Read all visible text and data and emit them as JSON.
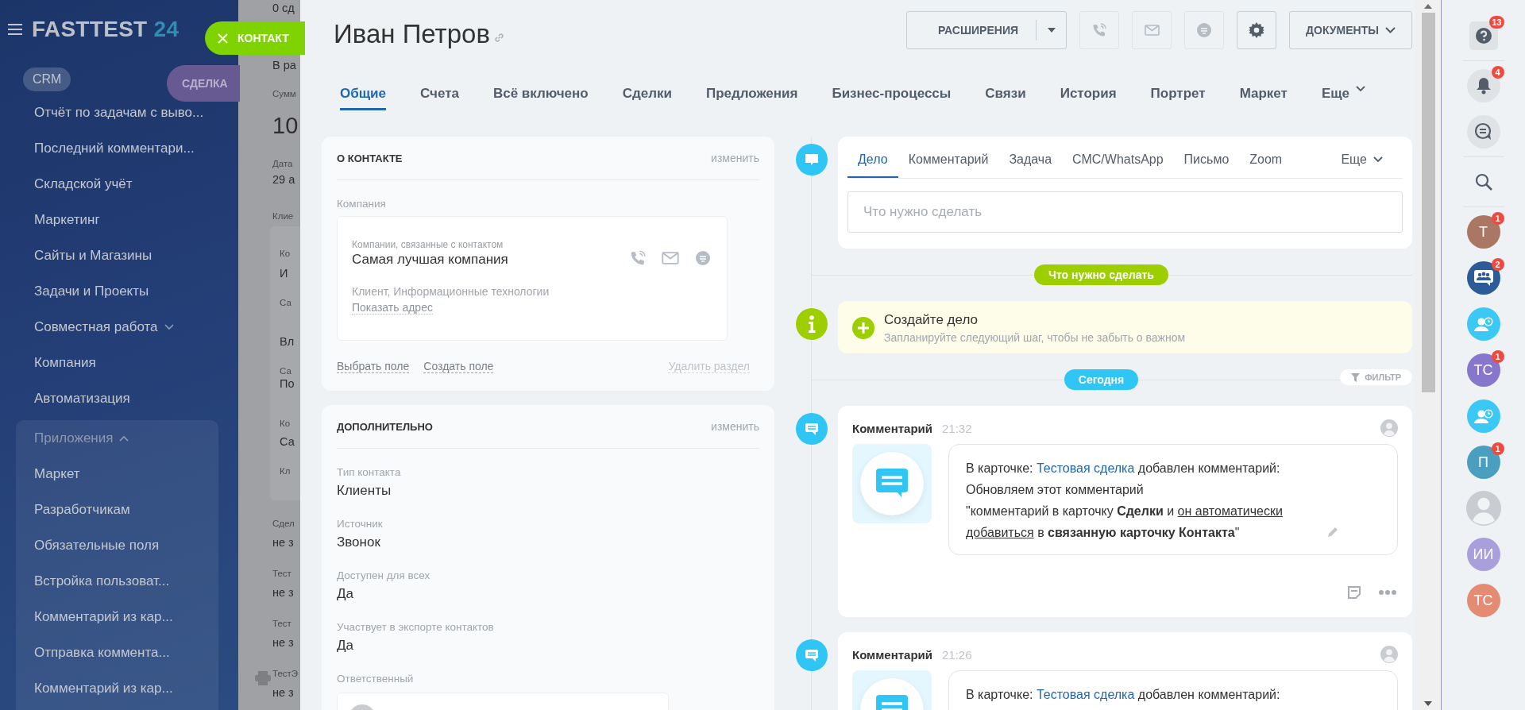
{
  "sidebar": {
    "logo": "FASTTEST",
    "logo_number": "24",
    "items": [
      {
        "label": "CRM",
        "kind": "pill"
      },
      {
        "label": "Отчёт по задачам с выво...",
        "kind": "item"
      },
      {
        "label": "Последний комментари...",
        "kind": "item"
      },
      {
        "label": "Складской учёт",
        "kind": "item"
      },
      {
        "label": "Маркетинг",
        "kind": "item"
      },
      {
        "label": "Сайты и Магазины",
        "kind": "item"
      },
      {
        "label": "Задачи и Проекты",
        "kind": "item"
      },
      {
        "label": "Совместная работа",
        "kind": "expandable",
        "expanded": false
      },
      {
        "label": "Компания",
        "kind": "item"
      },
      {
        "label": "Автоматизация",
        "kind": "item"
      },
      {
        "label": "Приложения",
        "kind": "group",
        "expanded": true,
        "children": [
          {
            "label": "Маркет"
          },
          {
            "label": "Разработчикам"
          },
          {
            "label": "Обязательные поля"
          },
          {
            "label": "Встройка пользоват..."
          },
          {
            "label": "Комментарий из кар..."
          },
          {
            "label": "Отправка коммента..."
          },
          {
            "label": "Комментарий из кар..."
          }
        ]
      }
    ]
  },
  "slider_tabs": [
    {
      "label": "КОНТАКТ",
      "kind": "close"
    },
    {
      "label": "СДЕЛКА",
      "kind": "plain"
    }
  ],
  "background_page": {
    "top": [
      {
        "text": "0 сд",
        "kind": "value"
      },
      {
        "text": "В ра",
        "kind": "value"
      },
      {
        "text": "Сумм",
        "kind": "small"
      },
      {
        "text": "10",
        "kind": "big"
      },
      {
        "text": "Дата",
        "kind": "small"
      },
      {
        "text": "29 а",
        "kind": "value"
      },
      {
        "text": "Клие",
        "kind": "small"
      }
    ],
    "card": [
      {
        "text": "Ко",
        "kind": "small"
      },
      {
        "text": "И",
        "kind": "name"
      },
      {
        "text": "Са",
        "kind": "small"
      },
      {
        "text": "Вл",
        "kind": "name"
      },
      {
        "text": "Са",
        "kind": "small"
      },
      {
        "text": "По",
        "kind": "value"
      },
      {
        "text": "Ко",
        "kind": "small"
      },
      {
        "text": "Са",
        "kind": "name"
      },
      {
        "text": "Кл",
        "kind": "small"
      }
    ],
    "bottom": [
      {
        "text": "Сдел",
        "kind": "small"
      },
      {
        "text": "не з",
        "kind": "value"
      },
      {
        "text": "Тест",
        "kind": "small"
      },
      {
        "text": "не з",
        "kind": "value"
      },
      {
        "text": "Тест",
        "kind": "small"
      },
      {
        "text": "не з",
        "kind": "value"
      },
      {
        "text": "ТестЭ",
        "kind": "small"
      },
      {
        "text": "не з",
        "kind": "value"
      }
    ]
  },
  "contact": {
    "title": "Иван Петров",
    "toolbar": [
      {
        "kind": "split",
        "label": "РАСШИРЕНИЯ"
      },
      {
        "kind": "phone",
        "disabled": true
      },
      {
        "kind": "mail",
        "disabled": true
      },
      {
        "kind": "chat",
        "disabled": true
      },
      {
        "kind": "gear",
        "disabled": false
      },
      {
        "kind": "dropdown",
        "label": "ДОКУМЕНТЫ"
      }
    ],
    "tabs": [
      {
        "label": "Общие",
        "selected": true
      },
      {
        "label": "Счета",
        "selected": false
      },
      {
        "label": "Всё включено",
        "selected": false
      },
      {
        "label": "Сделки",
        "selected": false
      },
      {
        "label": "Предложения",
        "selected": false
      },
      {
        "label": "Бизнес-процессы",
        "selected": false
      },
      {
        "label": "Связи",
        "selected": false
      },
      {
        "label": "История",
        "selected": false
      },
      {
        "label": "Портрет",
        "selected": false
      },
      {
        "label": "Маркет",
        "selected": false
      },
      {
        "label": "Еще",
        "selected": false
      }
    ],
    "about": {
      "title": "О КОНТАКТЕ",
      "edit": "изменить",
      "company_label": "Компания",
      "company": {
        "caption": "Компании, связанные с контактом",
        "name": "Самая лучшая компания",
        "details": "Клиент, Информационные технологии",
        "address_link": "Показать адрес"
      },
      "footer": [
        {
          "label": "Выбрать поле",
          "disabled": false
        },
        {
          "label": "Создать поле",
          "disabled": false
        },
        {
          "label": "Удалить раздел",
          "disabled": true
        }
      ]
    },
    "extra": {
      "title": "ДОПОЛНИТЕЛЬНО",
      "edit": "изменить",
      "fields": [
        {
          "label": "Тип контакта",
          "value": "Клиенты"
        },
        {
          "label": "Источник",
          "value": "Звонок"
        },
        {
          "label": "Доступен для всех",
          "value": "Да"
        },
        {
          "label": "Участвует в экспорте контактов",
          "value": "Да"
        }
      ],
      "responsible_label": "Ответственный"
    }
  },
  "timeline": {
    "editor": {
      "tabs": [
        {
          "label": "Дело",
          "selected": true
        },
        {
          "label": "Комментарий",
          "selected": false
        },
        {
          "label": "Задача",
          "selected": false
        },
        {
          "label": "СМС/WhatsApp",
          "selected": false
        },
        {
          "label": "Письмо",
          "selected": false
        },
        {
          "label": "Zoom",
          "selected": false
        }
      ],
      "more": "Еще",
      "placeholder": "Что нужно сделать"
    },
    "items": [
      {
        "kind": "divider",
        "label": "Что нужно сделать",
        "color": "#9dcf00"
      },
      {
        "kind": "create",
        "title": "Создайте дело",
        "subtitle": "Запланируйте следующий шаг, чтобы не забыть о важном"
      },
      {
        "kind": "divider",
        "label": "Сегодня",
        "color": "#2fc6f6",
        "filter": "ФИЛЬТР"
      },
      {
        "kind": "comment",
        "title": "Комментарий",
        "time": "21:32",
        "actions": true,
        "lines": [
          [
            {
              "kind": "text",
              "text": "В карточке: "
            },
            {
              "kind": "link",
              "text": "Тестовая сделка"
            },
            {
              "kind": "text",
              "text": " добавлен комментарий:"
            }
          ],
          [
            {
              "kind": "text",
              "text": "Обновляем этот комментарий"
            }
          ],
          [
            {
              "kind": "text",
              "text": "\"комментарий в карточку "
            },
            {
              "kind": "bold",
              "text": "Сделки"
            },
            {
              "kind": "text",
              "text": " и "
            },
            {
              "kind": "underline",
              "text": "он автоматически добавиться"
            },
            {
              "kind": "text",
              "text": " в "
            },
            {
              "kind": "bold",
              "text": "связанную карточку Контакта"
            },
            {
              "kind": "text",
              "text": "\""
            }
          ]
        ]
      },
      {
        "kind": "comment",
        "title": "Комментарий",
        "time": "21:26",
        "actions": false,
        "lines": [
          [
            {
              "kind": "text",
              "text": "В карточке: "
            },
            {
              "kind": "link",
              "text": "Тестовая сделка"
            },
            {
              "kind": "text",
              "text": " добавлен комментарий:"
            }
          ]
        ]
      }
    ]
  },
  "rail": [
    {
      "kind": "help",
      "badge": "13"
    },
    {
      "kind": "separator"
    },
    {
      "kind": "bell",
      "badge": "4"
    },
    {
      "kind": "chat"
    },
    {
      "kind": "separator"
    },
    {
      "kind": "search"
    },
    {
      "kind": "separator"
    },
    {
      "kind": "initials",
      "text": "Т",
      "color": "#a97763",
      "badge": "1"
    },
    {
      "kind": "group",
      "color": "#2b5c97",
      "badge": "2"
    },
    {
      "kind": "user-clock",
      "color": "#3bc8f5"
    },
    {
      "kind": "initials",
      "text": "ТС",
      "color": "#8677cc",
      "badge": "1"
    },
    {
      "kind": "user-clock",
      "color": "#3bc8f5"
    },
    {
      "kind": "initials",
      "text": "П",
      "color": "#4a9ec0",
      "badge": "1"
    },
    {
      "kind": "photo"
    },
    {
      "kind": "initials",
      "text": "ИИ",
      "color": "#a99fdb"
    },
    {
      "kind": "initials",
      "text": "ТС",
      "color": "#e38b73"
    }
  ]
}
